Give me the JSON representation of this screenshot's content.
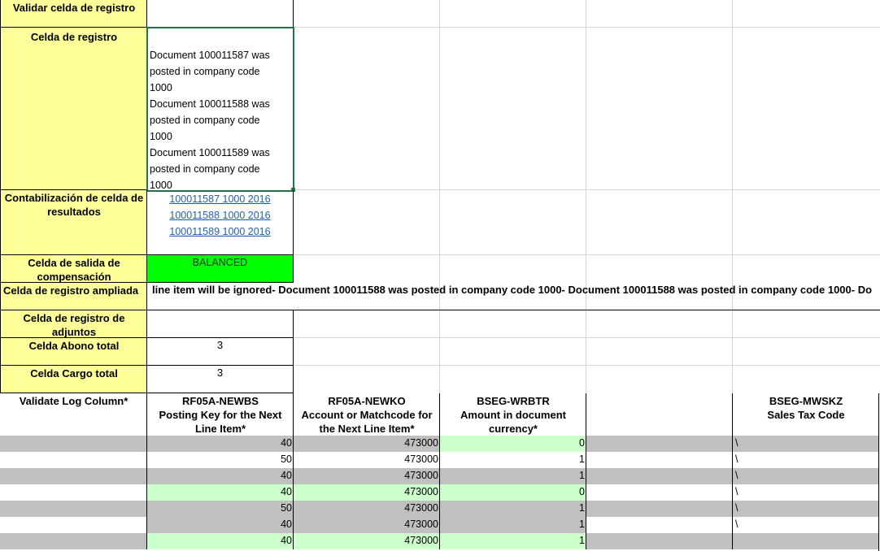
{
  "labels": {
    "validate_log_cell": "Validar celda de registro",
    "log_cell": "Celda de registro",
    "result_posting_cell": "Contabilización de celda de resultados",
    "clearing_output_cell": "Celda de salida de compensación",
    "extended_log_cell": "Celda de registro ampliada",
    "attachments_log_cell": "Celda de registro de adjuntos",
    "total_credit_cell": "Celda Abono total",
    "total_debit_cell": "Celda Cargo total"
  },
  "values": {
    "validate_log_value": "",
    "log_text": "Document 100011587 was\nposted in company code\n1000\nDocument 100011588 was\nposted in company code\n1000\nDocument 100011589 was\nposted in company code\n1000",
    "result_links": [
      "100011587 1000 2016",
      "100011588 1000 2016",
      "100011589 1000 2016"
    ],
    "clearing_status": "BALANCED",
    "extended_log": "line item will be ignored- Document 100011588 was posted in company code 1000- Document 100011588 was posted in company code 1000- Do",
    "attachments_log": "",
    "total_credit": "3",
    "total_debit": "3"
  },
  "colors": {
    "label_bg": "#ffff99",
    "balanced_bg": "#00ff00",
    "row_gray": "#c0c0c0",
    "row_green": "#ccffcc",
    "link": "#1f5fb4"
  },
  "table": {
    "headers": [
      "Validate Log Column*",
      "RF05A-NEWBS\nPosting Key for the Next Line Item*",
      "RF05A-NEWKO\nAccount or Matchcode for the Next Line Item*",
      "BSEG-WRBTR\nAmount in document currency*",
      "",
      "BSEG-MWSKZ\nSales Tax Code"
    ],
    "rows": [
      {
        "posting_key": "40",
        "account": "473000",
        "amount": "0",
        "tax": "\\",
        "style": [
          "gray",
          "gray",
          "gray",
          "green",
          "gray",
          "gray"
        ]
      },
      {
        "posting_key": "50",
        "account": "473000",
        "amount": "1",
        "tax": "\\",
        "style": [
          "white",
          "white",
          "white",
          "white",
          "white",
          "white"
        ]
      },
      {
        "posting_key": "40",
        "account": "473000",
        "amount": "1",
        "tax": "\\",
        "style": [
          "gray",
          "gray",
          "gray",
          "gray",
          "gray",
          "gray"
        ]
      },
      {
        "posting_key": "40",
        "account": "473000",
        "amount": "0",
        "tax": "\\",
        "style": [
          "white",
          "green",
          "green",
          "green",
          "white",
          "white"
        ]
      },
      {
        "posting_key": "50",
        "account": "473000",
        "amount": "1",
        "tax": "\\",
        "style": [
          "gray",
          "gray",
          "gray",
          "gray",
          "gray",
          "gray"
        ]
      },
      {
        "posting_key": "40",
        "account": "473000",
        "amount": "1",
        "tax": "\\",
        "style": [
          "white",
          "gray",
          "gray",
          "gray",
          "white",
          "white"
        ]
      },
      {
        "posting_key": "40",
        "account": "473000",
        "amount": "1",
        "tax": "",
        "style": [
          "gray",
          "green",
          "green",
          "green",
          "gray",
          "gray"
        ]
      }
    ]
  }
}
